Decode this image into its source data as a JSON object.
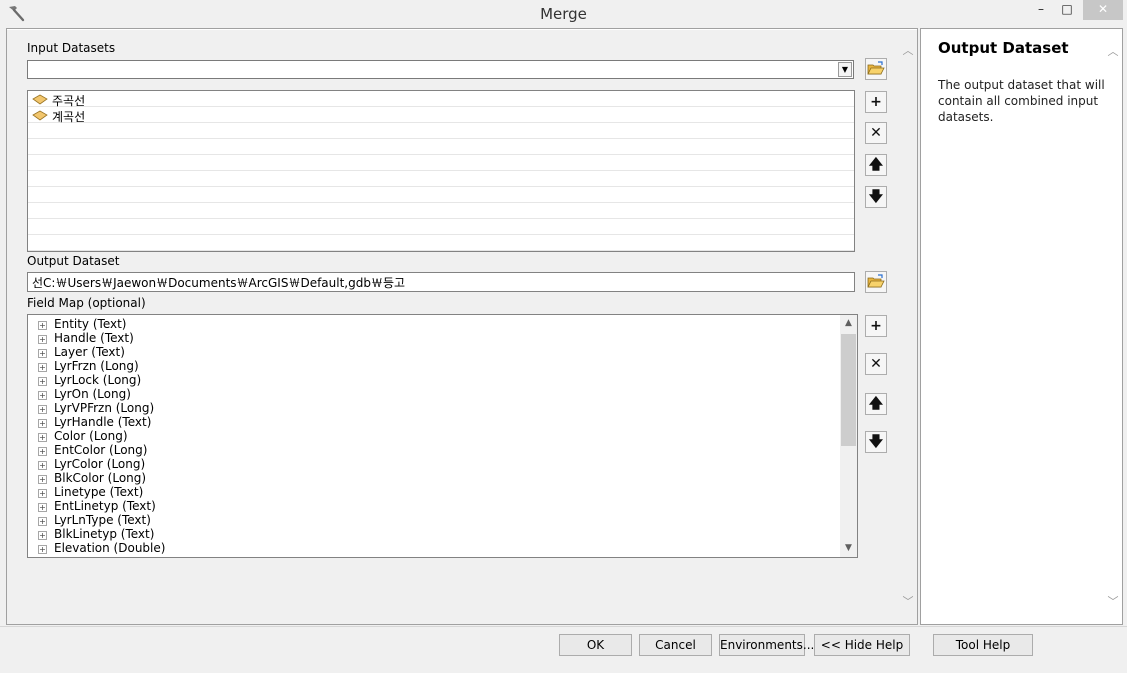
{
  "window": {
    "title": "Merge",
    "minimize": "–",
    "maximize": "□",
    "close": "✕"
  },
  "main": {
    "input_datasets_label": "Input Datasets",
    "input_datasets_combo_value": "",
    "dropdown_arrow": "▼",
    "input_list": [
      {
        "name": "주곡선",
        "icon": "feature-layer-icon"
      },
      {
        "name": "계곡선",
        "icon": "feature-layer-icon"
      }
    ],
    "output_dataset_label": "Output Dataset",
    "output_dataset_value": "선C:￦Users￦Jaewon￦Documents￦ArcGIS￦Default,gdb￦등고",
    "field_map_label": "Field Map (optional)",
    "field_map_items": [
      "Entity (Text)",
      "Handle (Text)",
      "Layer (Text)",
      "LyrFrzn (Long)",
      "LyrLock (Long)",
      "LyrOn (Long)",
      "LyrVPFrzn (Long)",
      "LyrHandle (Text)",
      "Color (Long)",
      "EntColor (Long)",
      "LyrColor (Long)",
      "BlkColor (Long)",
      "Linetype (Text)",
      "EntLinetyp (Text)",
      "LyrLnType (Text)",
      "BlkLinetyp (Text)",
      "Elevation (Double)"
    ],
    "tree_expander": "+",
    "side_buttons": {
      "add": "+",
      "remove": "✕",
      "up": "🡅",
      "down": "🡇"
    },
    "scroll": {
      "up": "▲",
      "down": "▼",
      "pane_up": "︿",
      "pane_down": "﹀"
    }
  },
  "help": {
    "title": "Output Dataset",
    "body": "The output dataset that will contain all combined input datasets."
  },
  "buttons": {
    "ok": "OK",
    "cancel": "Cancel",
    "environments": "Environments...",
    "hide_help": "<< Hide Help",
    "tool_help": "Tool Help"
  }
}
